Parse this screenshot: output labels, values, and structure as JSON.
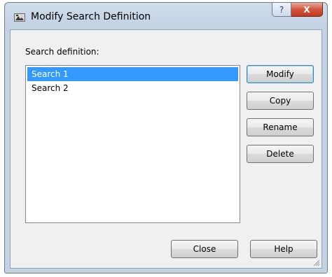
{
  "window": {
    "title": "Modify Search Definition",
    "help_caption": "?",
    "close_caption": "X"
  },
  "dialog": {
    "list_label": "Search definition:",
    "items": [
      {
        "label": "Search 1",
        "selected": true
      },
      {
        "label": "Search 2",
        "selected": false
      }
    ],
    "buttons": {
      "modify": "Modify",
      "copy": "Copy",
      "rename": "Rename",
      "delete": "Delete",
      "close": "Close",
      "help": "Help"
    }
  },
  "colors": {
    "selection": "#3399ff",
    "close_button": "#c33a1f"
  }
}
